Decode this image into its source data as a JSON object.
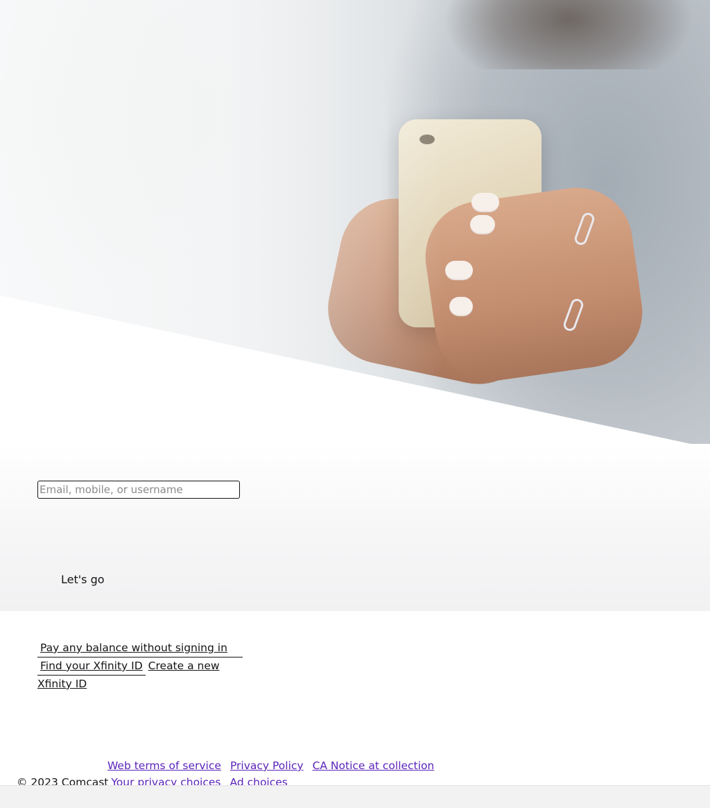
{
  "sign_in": {
    "id_placeholder": "Email, mobile, or username",
    "submit_label": "Let's go"
  },
  "help": {
    "pay_balance": "Pay any balance without signing in",
    "find_id": "Find your Xfinity ID",
    "create_id": "Create a new Xfinity ID"
  },
  "footer": {
    "copyright": "© 2023 Comcast",
    "links": [
      "Web terms of service",
      "Privacy Policy",
      "CA Notice at collection",
      "Your privacy choices",
      "Ad choices"
    ],
    "link_color": "#5a23b9"
  }
}
